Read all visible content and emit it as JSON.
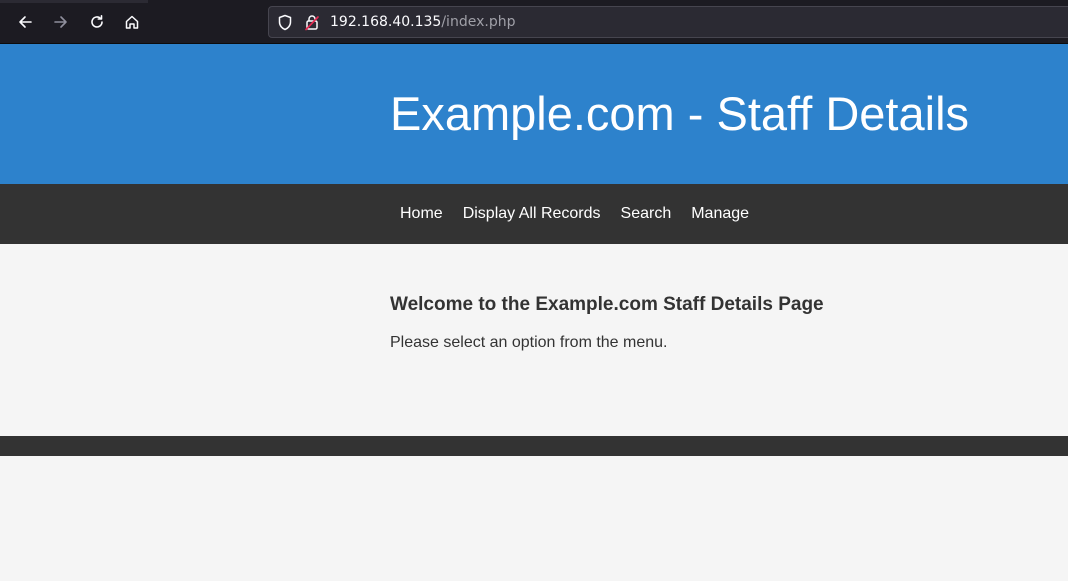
{
  "browser": {
    "address": {
      "host": "192.168.40.135",
      "path": "/index.php"
    },
    "icons": {
      "back": "back-arrow-icon",
      "forward": "forward-arrow-icon",
      "reload": "reload-icon",
      "home": "home-icon",
      "tracking": "shield-icon",
      "connection": "insecure-lock-icon"
    }
  },
  "site": {
    "title": "Example.com - Staff Details",
    "nav": [
      {
        "label": "Home"
      },
      {
        "label": "Display All Records"
      },
      {
        "label": "Search"
      },
      {
        "label": "Manage"
      }
    ],
    "content": {
      "heading": "Welcome to the Example.com Staff Details Page",
      "text": "Please select an option from the menu."
    }
  },
  "colors": {
    "header_bg": "#2d82cc",
    "nav_bg": "#333333",
    "page_bg": "#f5f5f5",
    "chrome_bg": "#1c1b22"
  }
}
